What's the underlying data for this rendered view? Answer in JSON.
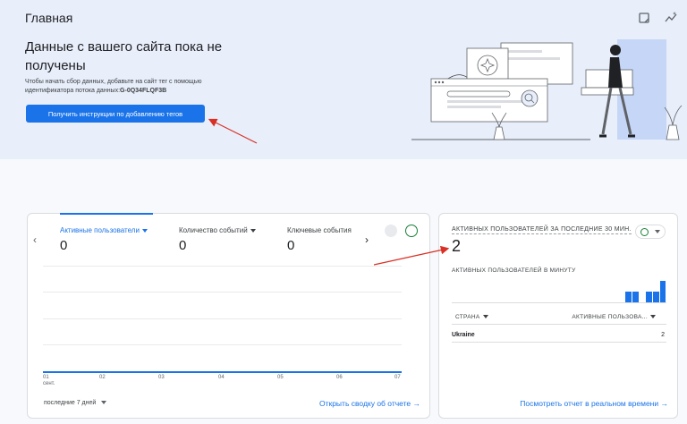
{
  "header": {
    "title": "Главная"
  },
  "banner": {
    "headline": "Данные с вашего сайта пока не получены",
    "description": "Чтобы начать сбор данных, добавьте на сайт тег с помощью идентификатора потока данных:",
    "stream_id": "G-0Q34FLQF3B",
    "cta_label": "Получить инструкции по добавлению тегов"
  },
  "overview_card": {
    "metrics": [
      {
        "label": "Активные пользователи",
        "value": "0",
        "active": true
      },
      {
        "label": "Количество событий",
        "value": "0"
      },
      {
        "label": "Ключевые события",
        "value": "0"
      }
    ],
    "x_ticks": [
      "01",
      "02",
      "03",
      "04",
      "05",
      "06",
      "07"
    ],
    "x_month": "сент.",
    "period": "последние 7 дней",
    "report_link": "Открыть сводку об отчете"
  },
  "realtime_card": {
    "label": "АКТИВНЫХ ПОЛЬЗОВАТЕЛЕЙ ЗА ПОСЛЕДНИЕ 30 МИН.",
    "value": "2",
    "per_minute_label": "АКТИВНЫХ ПОЛЬЗОВАТЕЛЕЙ В МИНУТУ",
    "per_minute_values": [
      0,
      0,
      0,
      0,
      0,
      0,
      0,
      0,
      0,
      0,
      0,
      0,
      0,
      0,
      0,
      0,
      0,
      0,
      0,
      0,
      0,
      0,
      0,
      0,
      0,
      1,
      1,
      0,
      1,
      1,
      2
    ],
    "table_headers": [
      "СТРАНА",
      "АКТИВНЫЕ ПОЛЬЗОВА..."
    ],
    "rows": [
      {
        "country": "Ukraine",
        "value": "2"
      }
    ],
    "link": "Посмотреть отчет в реальном времени"
  },
  "colors": {
    "accent": "#1a73e8",
    "success": "#188038",
    "annotation": "#d93025"
  },
  "icons": [
    "note-icon",
    "insights-icon",
    "chevron-left-icon",
    "chevron-right-icon",
    "compare-icon",
    "check-circle-icon",
    "arrow-right-icon",
    "dropdown-caret-icon"
  ]
}
